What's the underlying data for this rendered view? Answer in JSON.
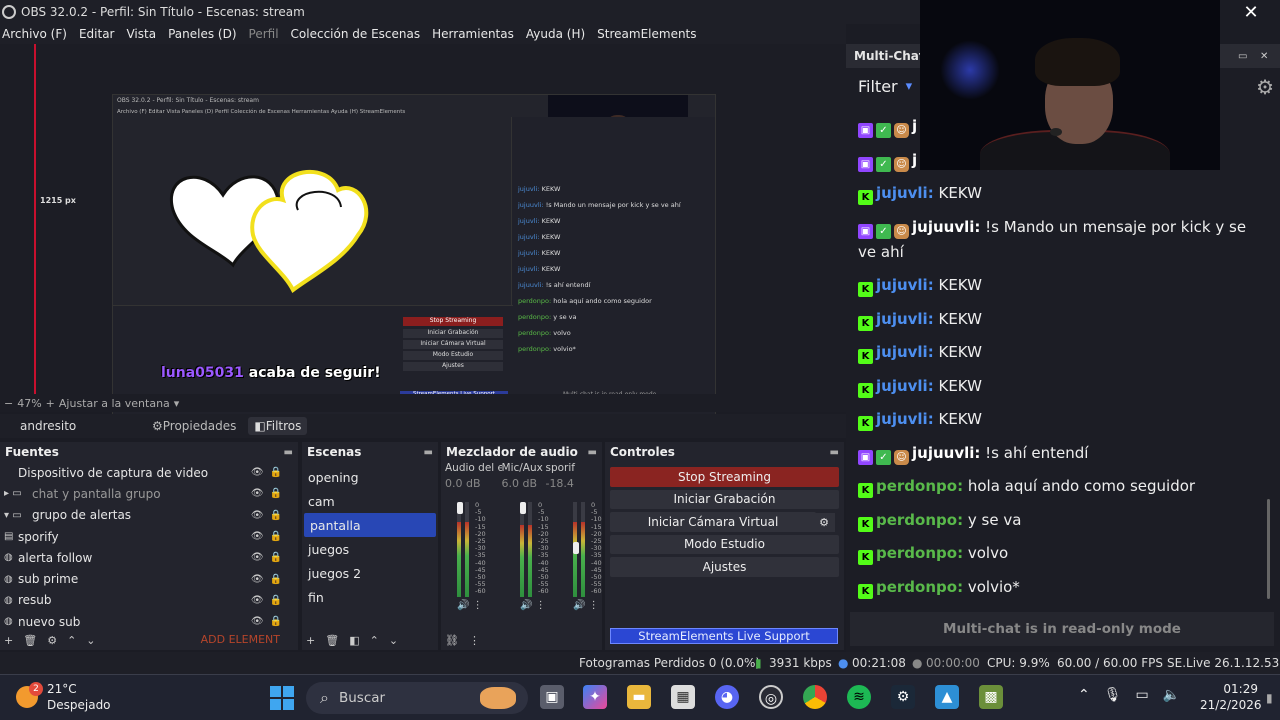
{
  "window": {
    "title": "OBS 32.0.2 - Perfil: Sin Título - Escenas: stream"
  },
  "menu": [
    {
      "label": "Archivo (F)",
      "dim": false
    },
    {
      "label": "Editar",
      "dim": false
    },
    {
      "label": "Vista",
      "dim": false
    },
    {
      "label": "Paneles (D)",
      "dim": false
    },
    {
      "label": "Perfil",
      "dim": true
    },
    {
      "label": "Colección de Escenas",
      "dim": false
    },
    {
      "label": "Herramientas",
      "dim": false
    },
    {
      "label": "Ayuda (H)",
      "dim": false
    },
    {
      "label": "StreamElements",
      "dim": false
    }
  ],
  "preview": {
    "zoom": "47%",
    "fit_label": "Ajustar a la ventana",
    "height_label": "1215 px",
    "alert_user": "luna05031",
    "alert_text": "acaba de seguir!"
  },
  "nested": {
    "title": "OBS 32.0.2 - Perfil: Sin Título - Escenas: stream",
    "menu": "Archivo (F)  Editar  Vista  Paneles (D)  Perfil  Colección de Escenas  Herramientas  Ayuda (H)  StreamElements",
    "chat_lines": [
      {
        "user": "jujuvli:",
        "text": "KEKW"
      },
      {
        "user": "jujuuvli:",
        "text": "!s Mando un mensaje por kick y se ve ahí"
      },
      {
        "user": "jujuvli:",
        "text": "KEKW"
      },
      {
        "user": "jujuvli:",
        "text": "KEKW"
      },
      {
        "user": "jujuvli:",
        "text": "KEKW"
      },
      {
        "user": "jujuvli:",
        "text": "KEKW"
      },
      {
        "user": "jujuuvli:",
        "text": "!s ahí entendí"
      },
      {
        "user": "perdonpo:",
        "text": "hola aquí ando como seguidor"
      },
      {
        "user": "perdonpo:",
        "text": "y se va"
      },
      {
        "user": "perdonpo:",
        "text": "volvo"
      },
      {
        "user": "perdonpo:",
        "text": "volvio*"
      }
    ],
    "readonly": "Multi-chat is in read-only mode",
    "stop": "Stop Streaming",
    "buttons": [
      "Iniciar Grabación",
      "Iniciar Cámara Virtual",
      "Modo Estudio",
      "Ajustes"
    ],
    "se_live": "StreamElements Live Support"
  },
  "context": {
    "source": "andresito",
    "props": "Propiedades",
    "filters": "Filtros"
  },
  "fuentes": {
    "title": "Fuentes",
    "items": [
      {
        "name": "Dispositivo de captura de video",
        "glyph": "",
        "dim": false
      },
      {
        "name": "chat y pantalla grupo",
        "glyph": "▸ ▭",
        "dim": true
      },
      {
        "name": "grupo de alertas",
        "glyph": "▾ ▭",
        "dim": false
      },
      {
        "name": "sporify",
        "glyph": "▤",
        "dim": false
      },
      {
        "name": "alerta follow",
        "glyph": "◍",
        "dim": false
      },
      {
        "name": "sub prime",
        "glyph": "◍",
        "dim": false
      },
      {
        "name": "resub",
        "glyph": "◍",
        "dim": false
      },
      {
        "name": "nuevo sub",
        "glyph": "◍",
        "dim": false
      }
    ],
    "add_element": "ADD ELEMENT"
  },
  "escenas": {
    "title": "Escenas",
    "items": [
      "opening",
      "cam",
      "pantalla",
      "juegos",
      "juegos 2",
      "fin"
    ],
    "selected": "pantalla"
  },
  "mezclador": {
    "title": "Mezclador de audio",
    "channels": [
      {
        "name": "Audio del escri",
        "db": "0.0 dB"
      },
      {
        "name": "Mic/Aux",
        "db": "6.0 dB"
      },
      {
        "name": "sporif",
        "db": "-18.4"
      }
    ],
    "scale": [
      "0",
      "-5",
      "-10",
      "-15",
      "-20",
      "-25",
      "-30",
      "-35",
      "-40",
      "-45",
      "-50",
      "-55",
      "-60"
    ]
  },
  "controles": {
    "title": "Controles",
    "stop": "Stop Streaming",
    "record": "Iniciar Grabación",
    "virtualcam": "Iniciar Cámara Virtual",
    "studio": "Modo Estudio",
    "settings": "Ajustes",
    "se_live": "StreamElements Live Support"
  },
  "status": {
    "dropped": "Fotogramas Perdidos 0 (0.0%)",
    "bitrate": "3931 kbps",
    "stream_time": "00:21:08",
    "rec_time": "00:00:00",
    "cpu": "CPU: 9.9%",
    "fps": "60.00 / 60.00 FPS",
    "version": "SE.Live 26.1.12.537"
  },
  "chat": {
    "header": "Multi-Chat",
    "filter": "Filter",
    "messages": [
      {
        "badges": [
          "tw",
          "chk",
          "face"
        ],
        "user": "j",
        "color": "white",
        "text": ""
      },
      {
        "badges": [
          "tw",
          "chk",
          "face"
        ],
        "user": "j",
        "color": "white",
        "text": ""
      },
      {
        "badges": [
          "kick"
        ],
        "user": "jujuvli:",
        "color": "blue",
        "text": "KEKW"
      },
      {
        "badges": [
          "tw",
          "chk",
          "face"
        ],
        "user": "jujuuvli:",
        "color": "white",
        "text": "!s Mando un mensaje por kick y se ve ahí"
      },
      {
        "badges": [
          "kick"
        ],
        "user": "jujuvli:",
        "color": "blue",
        "text": "KEKW"
      },
      {
        "badges": [
          "kick"
        ],
        "user": "jujuvli:",
        "color": "blue",
        "text": "KEKW"
      },
      {
        "badges": [
          "kick"
        ],
        "user": "jujuvli:",
        "color": "blue",
        "text": "KEKW"
      },
      {
        "badges": [
          "kick"
        ],
        "user": "jujuvli:",
        "color": "blue",
        "text": "KEKW"
      },
      {
        "badges": [
          "kick"
        ],
        "user": "jujuvli:",
        "color": "blue",
        "text": "KEKW"
      },
      {
        "badges": [
          "tw",
          "chk",
          "face"
        ],
        "user": "jujuuvli:",
        "color": "white",
        "text": "!s ahí entendí"
      },
      {
        "badges": [
          "kick"
        ],
        "user": "perdonpo:",
        "color": "green",
        "text": "hola aquí ando como seguidor"
      },
      {
        "badges": [
          "kick"
        ],
        "user": "perdonpo:",
        "color": "green",
        "text": "y se va"
      },
      {
        "badges": [
          "kick"
        ],
        "user": "perdonpo:",
        "color": "green",
        "text": "volvo"
      },
      {
        "badges": [
          "kick"
        ],
        "user": "perdonpo:",
        "color": "green",
        "text": "volvio*"
      }
    ],
    "readonly": "Multi-chat is in read-only mode"
  },
  "taskbar": {
    "temp": "21°C",
    "weather": "Despejado",
    "weather_badge": "2",
    "search_placeholder": "Buscar",
    "time": "01:29",
    "date": "21/2/2026"
  },
  "colors": {
    "accent": "#2847b5",
    "stop": "#8a2421",
    "kick": "#53fc18",
    "twitch": "#9146ff"
  }
}
